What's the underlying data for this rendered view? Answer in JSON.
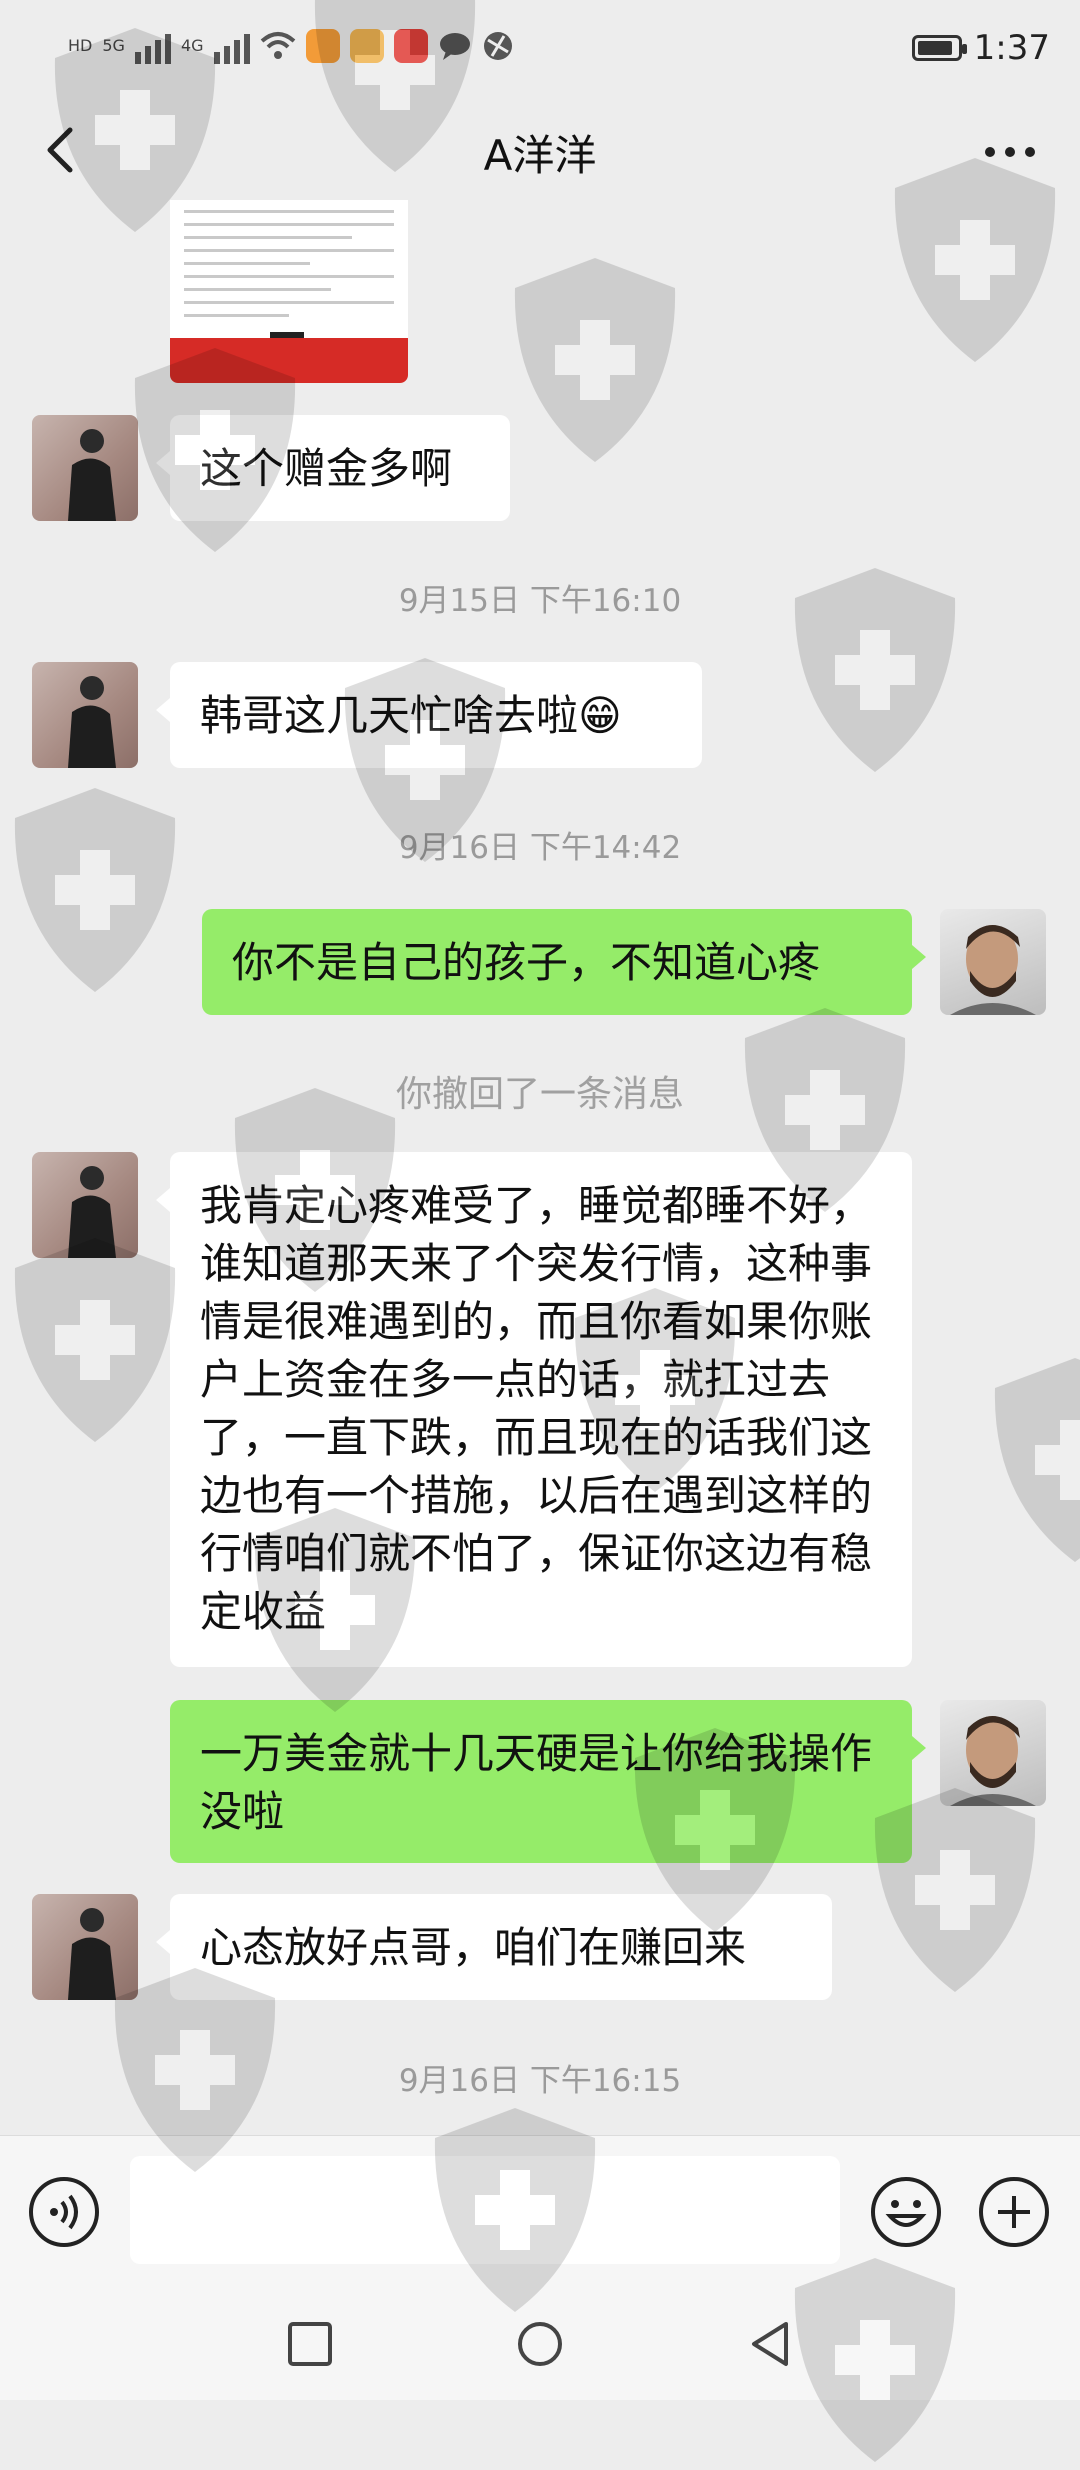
{
  "status_bar": {
    "network_labels": [
      "HD",
      "5G",
      "4G"
    ],
    "time": "1:37",
    "battery_level": 0.9
  },
  "header": {
    "title": "A洋洋",
    "back_icon": "chevron-left-icon",
    "more_icon": "more-dots-icon"
  },
  "messages": {
    "m1": "这个赠金多啊",
    "t1": "9月15日 下午16:10",
    "m2": "韩哥这几天忙啥去啦😁",
    "t2": "9月16日 下午14:42",
    "m3": "你不是自己的孩子，不知道心疼",
    "recall": "你撤回了一条消息",
    "m4": "我肯定心疼难受了，睡觉都睡不好，谁知道那天来了个突发行情，这种事情是很难遇到的，而且你看如果你账户上资金在多一点的话，就扛过去了，一直下跌，而且现在的话我们这边也有一个措施，以后在遇到这样的行情咱们就不怕了，保证你这边有稳定收益",
    "m5": "一万美金就十几天硬是让你给我操作没啦",
    "m6": "心态放好点哥，咱们在赚回来",
    "t3": "9月16日 下午16:15"
  },
  "input_bar": {
    "value": "",
    "voice_icon": "voice-icon",
    "emoji_icon": "emoji-icon",
    "plus_icon": "plus-icon"
  },
  "colors": {
    "background": "#ededed",
    "outgoing_bubble": "#95ec69",
    "incoming_bubble": "#ffffff",
    "timestamp": "#9a9a9a"
  }
}
